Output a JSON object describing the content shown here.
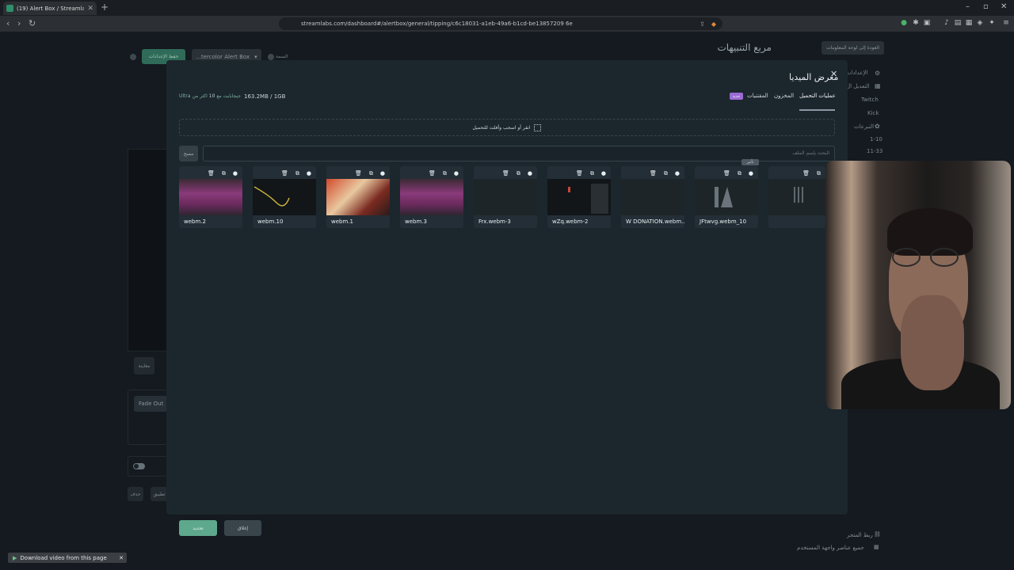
{
  "browser": {
    "tab_title": "(19) Alert Box / Streamlabs",
    "url": "streamlabs.com/dashboard#/alertbox/general/tipping/c6c18031-a1eb-49a6-b1cd-be13857209 6e",
    "window_controls": [
      "–",
      "▫",
      "✕"
    ]
  },
  "page": {
    "title": "مربع التنبيهات",
    "back_button": "العودة إلى لوحة المعلومات",
    "sidebar": [
      "الإعدادات",
      "التعديل ال",
      "Twitch",
      "Kick",
      "التبرعات",
      "1-10",
      "11-33"
    ],
    "save_button": "حفظ الإعدادات",
    "theme_select": "...tercolor Alert Box",
    "theme_label": "السمة",
    "preview_btn": "معاينة",
    "fade_out": "Fade Out",
    "reset_btn": "تطبيق",
    "restore_btn": "حذف",
    "footer_link": "ربط المتجر",
    "footer_widgets": "جميع عناصر واجهة المستخدم"
  },
  "modal": {
    "title": "معرض الميديا",
    "close": "✕",
    "tabs": [
      "عمليات التحميل",
      "المخزون",
      "المقتنيات"
    ],
    "new_badge": "جديد",
    "storage_used": "163.2MB / 1GB",
    "ultra_note_prefix": "اكثر من",
    "ultra_note_count": "10",
    "ultra_note_suffix": "جيجابايت مع",
    "ultra_label": "Ultra",
    "dropzone": "انقر أو اسحب وأفلت للتحميل",
    "search_placeholder": "البحث بإسم الملف",
    "search_button": "مسح",
    "tooltip": "تأثير",
    "cancel": "إغلاق",
    "select": "تحديد",
    "files": [
      {
        "name": "webm.2",
        "thumb": "pink"
      },
      {
        "name": "webm.10",
        "thumb": "dark-line"
      },
      {
        "name": "webm.1",
        "thumb": "anime"
      },
      {
        "name": "webm.3",
        "thumb": "pink"
      },
      {
        "name": "Frx.webm-3",
        "thumb": "dark"
      },
      {
        "name": "wZq.webm-2",
        "thumb": "dark-figure"
      },
      {
        "name": "W DONATION.webm...",
        "thumb": "black"
      },
      {
        "name": "JFtwvg.webm_10",
        "thumb": "logo"
      },
      {
        "name": "",
        "thumb": "bars"
      }
    ]
  },
  "download_bar": "Download video from this page"
}
